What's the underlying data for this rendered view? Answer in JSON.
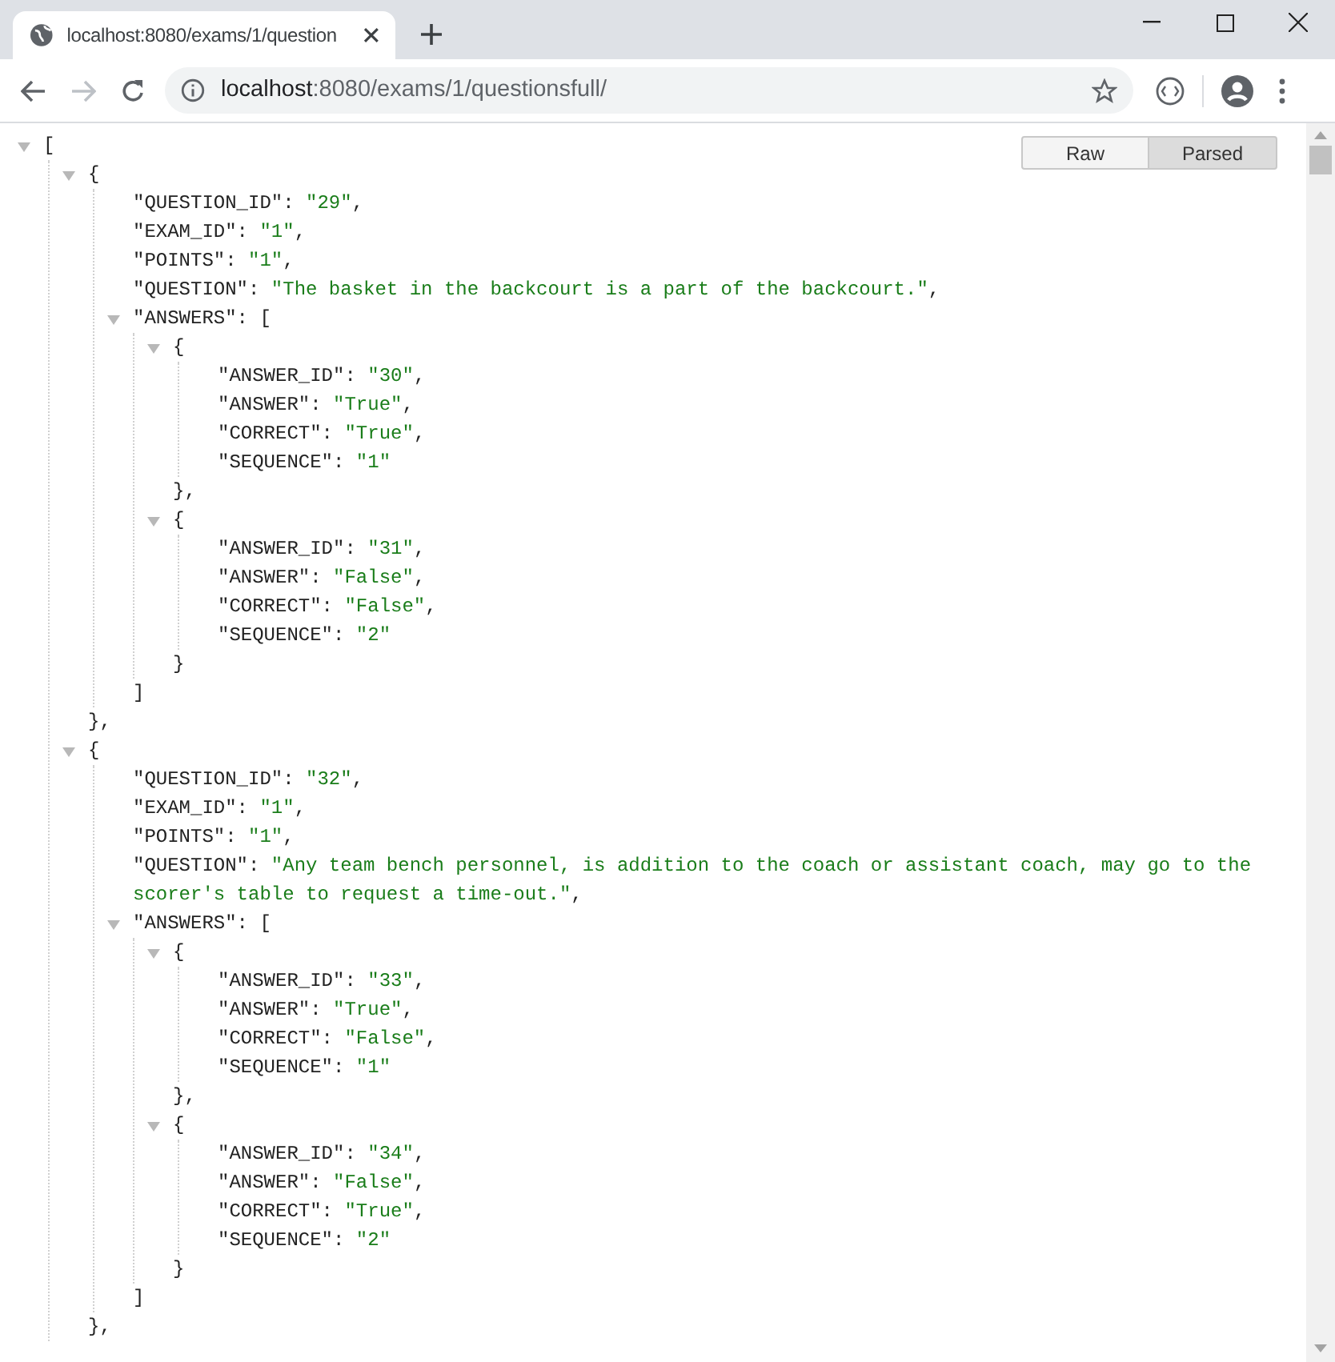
{
  "browser": {
    "tab": {
      "title": "localhost:8080/exams/1/question"
    },
    "address": {
      "host": "localhost",
      "path": ":8080/exams/1/questionsfull/"
    }
  },
  "view_toggle": [
    {
      "label": "Raw",
      "selected": false
    },
    {
      "label": "Parsed",
      "selected": true
    }
  ],
  "document": {
    "kind": "container",
    "open": "[",
    "expanded": true,
    "children": [
      {
        "kind": "container",
        "open": "{",
        "expanded": true,
        "close": "}",
        "trailing": ",",
        "children": [
          {
            "kind": "pair",
            "key": "\"QUESTION_ID\":",
            "value": "\"29\"",
            "trailing": ","
          },
          {
            "kind": "pair",
            "key": "\"EXAM_ID\":",
            "value": "\"1\"",
            "trailing": ","
          },
          {
            "kind": "pair",
            "key": "\"POINTS\":",
            "value": "\"1\"",
            "trailing": ","
          },
          {
            "kind": "pair",
            "key": "\"QUESTION\":",
            "value": "\"The basket in the backcourt is a part of the backcourt.\"",
            "trailing": ","
          },
          {
            "kind": "container",
            "key": "\"ANSWERS\":",
            "open": "[",
            "expanded": true,
            "close": "]",
            "children": [
              {
                "kind": "container",
                "open": "{",
                "expanded": true,
                "close": "}",
                "trailing": ",",
                "children": [
                  {
                    "kind": "pair",
                    "key": "\"ANSWER_ID\":",
                    "value": "\"30\"",
                    "trailing": ","
                  },
                  {
                    "kind": "pair",
                    "key": "\"ANSWER\":",
                    "value": "\"True\"",
                    "trailing": ","
                  },
                  {
                    "kind": "pair",
                    "key": "\"CORRECT\":",
                    "value": "\"True\"",
                    "trailing": ","
                  },
                  {
                    "kind": "pair",
                    "key": "\"SEQUENCE\":",
                    "value": "\"1\""
                  }
                ]
              },
              {
                "kind": "container",
                "open": "{",
                "expanded": true,
                "close": "}",
                "children": [
                  {
                    "kind": "pair",
                    "key": "\"ANSWER_ID\":",
                    "value": "\"31\"",
                    "trailing": ","
                  },
                  {
                    "kind": "pair",
                    "key": "\"ANSWER\":",
                    "value": "\"False\"",
                    "trailing": ","
                  },
                  {
                    "kind": "pair",
                    "key": "\"CORRECT\":",
                    "value": "\"False\"",
                    "trailing": ","
                  },
                  {
                    "kind": "pair",
                    "key": "\"SEQUENCE\":",
                    "value": "\"2\""
                  }
                ]
              }
            ]
          }
        ]
      },
      {
        "kind": "container",
        "open": "{",
        "expanded": true,
        "close": "}",
        "trailing": ",",
        "children": [
          {
            "kind": "pair",
            "key": "\"QUESTION_ID\":",
            "value": "\"32\"",
            "trailing": ","
          },
          {
            "kind": "pair",
            "key": "\"EXAM_ID\":",
            "value": "\"1\"",
            "trailing": ","
          },
          {
            "kind": "pair",
            "key": "\"POINTS\":",
            "value": "\"1\"",
            "trailing": ","
          },
          {
            "kind": "pair",
            "key": "\"QUESTION\":",
            "value": "\"Any team bench personnel, is addition to the coach or assistant coach, may go to the scorer's table to request a time-out.\"",
            "trailing": ","
          },
          {
            "kind": "container",
            "key": "\"ANSWERS\":",
            "open": "[",
            "expanded": true,
            "close": "]",
            "children": [
              {
                "kind": "container",
                "open": "{",
                "expanded": true,
                "close": "}",
                "trailing": ",",
                "children": [
                  {
                    "kind": "pair",
                    "key": "\"ANSWER_ID\":",
                    "value": "\"33\"",
                    "trailing": ","
                  },
                  {
                    "kind": "pair",
                    "key": "\"ANSWER\":",
                    "value": "\"True\"",
                    "trailing": ","
                  },
                  {
                    "kind": "pair",
                    "key": "\"CORRECT\":",
                    "value": "\"False\"",
                    "trailing": ","
                  },
                  {
                    "kind": "pair",
                    "key": "\"SEQUENCE\":",
                    "value": "\"1\""
                  }
                ]
              },
              {
                "kind": "container",
                "open": "{",
                "expanded": true,
                "close": "}",
                "children": [
                  {
                    "kind": "pair",
                    "key": "\"ANSWER_ID\":",
                    "value": "\"34\"",
                    "trailing": ","
                  },
                  {
                    "kind": "pair",
                    "key": "\"ANSWER\":",
                    "value": "\"False\"",
                    "trailing": ","
                  },
                  {
                    "kind": "pair",
                    "key": "\"CORRECT\":",
                    "value": "\"True\"",
                    "trailing": ","
                  },
                  {
                    "kind": "pair",
                    "key": "\"SEQUENCE\":",
                    "value": "\"2\""
                  }
                ]
              }
            ]
          }
        ]
      }
    ]
  }
}
